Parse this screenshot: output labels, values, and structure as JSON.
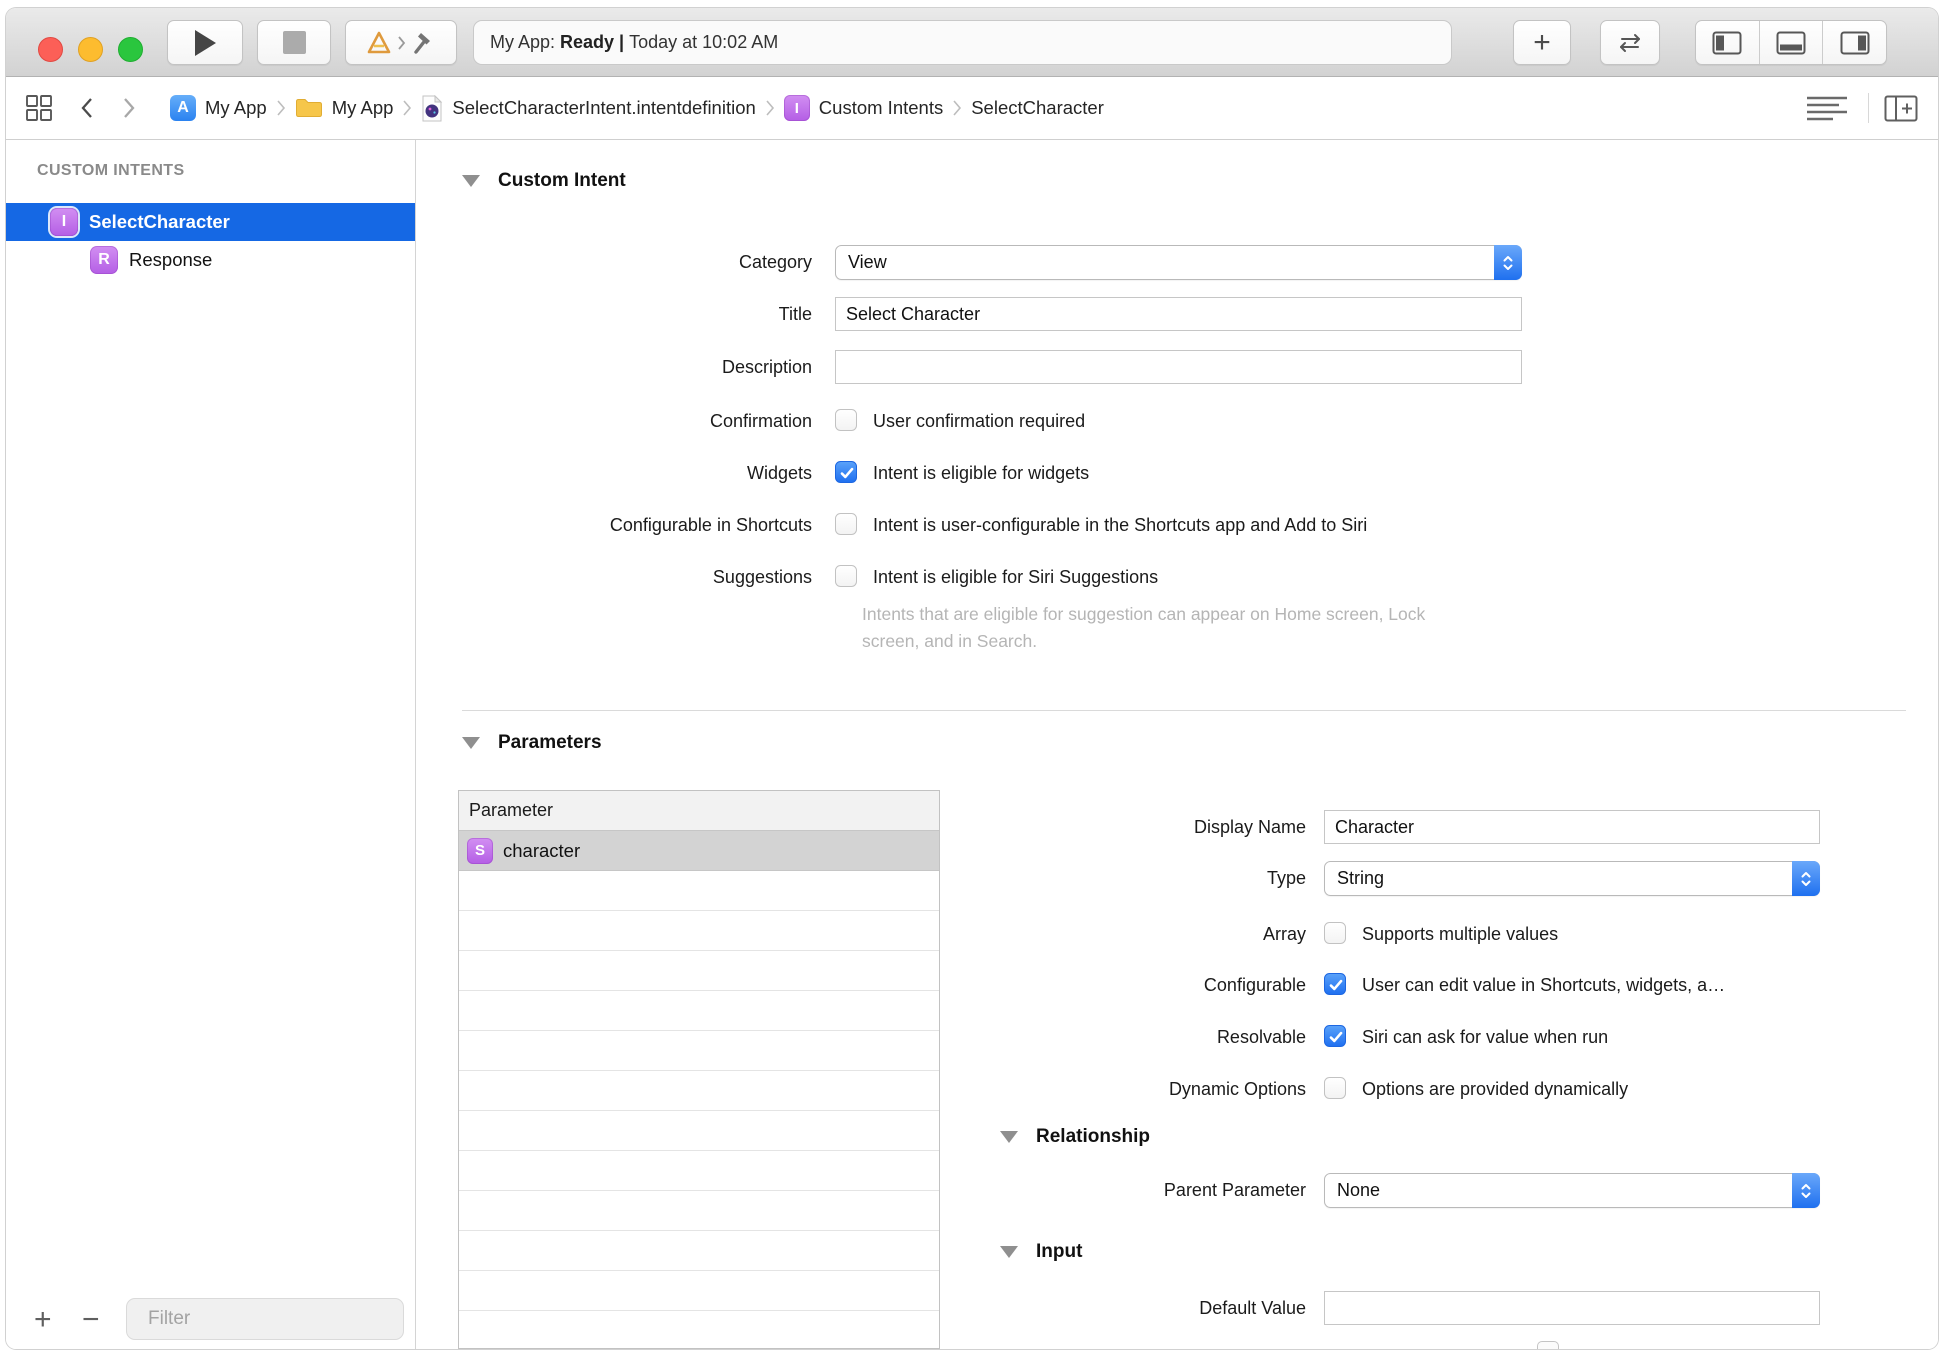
{
  "toolbar": {
    "status_project": "My App: ",
    "status_state": "Ready | ",
    "status_detail": "Today at 10:02 AM",
    "add_label": "+"
  },
  "jumpbar": {
    "crumbs": [
      {
        "label": "My App"
      },
      {
        "label": "My App"
      },
      {
        "label": "SelectCharacterIntent.intentdefinition"
      },
      {
        "label": "Custom Intents",
        "badge": "I"
      },
      {
        "label": "SelectCharacter"
      }
    ]
  },
  "sidebar": {
    "header": "CUSTOM INTENTS",
    "items": [
      {
        "badge": "I",
        "label": "SelectCharacter",
        "selected": true
      },
      {
        "badge": "R",
        "label": "Response",
        "selected": false
      }
    ],
    "add": "+",
    "remove": "−",
    "filter_placeholder": "Filter"
  },
  "editor": {
    "custom_intent": {
      "title": "Custom Intent",
      "category": {
        "label": "Category",
        "value": "View"
      },
      "title_field": {
        "label": "Title",
        "value": "Select Character"
      },
      "description": {
        "label": "Description",
        "value": ""
      },
      "confirmation": {
        "label": "Confirmation",
        "text": "User confirmation required",
        "checked": false
      },
      "widgets": {
        "label": "Widgets",
        "text": "Intent is eligible for widgets",
        "checked": true
      },
      "shortcuts": {
        "label": "Configurable in Shortcuts",
        "text": "Intent is user-configurable in the Shortcuts app and Add to Siri",
        "checked": false
      },
      "suggestions": {
        "label": "Suggestions",
        "text": "Intent is eligible for Siri Suggestions",
        "checked": false
      },
      "suggestions_help": "Intents that are eligible for suggestion can appear on Home screen, Lock screen, and in Search."
    },
    "parameters": {
      "title": "Parameters",
      "table": {
        "header": "Parameter",
        "rows": [
          {
            "badge": "S",
            "name": "character"
          }
        ]
      },
      "detail": {
        "display_name": {
          "label": "Display Name",
          "value": "Character"
        },
        "type": {
          "label": "Type",
          "value": "String"
        },
        "array": {
          "label": "Array",
          "text": "Supports multiple values",
          "checked": false
        },
        "configurable": {
          "label": "Configurable",
          "text": "User can edit value in Shortcuts, widgets, a…",
          "checked": true
        },
        "resolvable": {
          "label": "Resolvable",
          "text": "Siri can ask for value when run",
          "checked": true
        },
        "dynamic_options": {
          "label": "Dynamic Options",
          "text": "Options are provided dynamically",
          "checked": false
        }
      },
      "relationship": {
        "title": "Relationship",
        "parent": {
          "label": "Parent Parameter",
          "value": "None"
        }
      },
      "input": {
        "title": "Input",
        "default_value": {
          "label": "Default Value",
          "value": ""
        }
      }
    }
  },
  "colors": {
    "selection_blue": "#1568e4",
    "control_blue": "#2a7cf7",
    "intent_purple": "#bf6fe9",
    "traffic_red": "#fc5f57",
    "traffic_yellow": "#fdbc2f",
    "traffic_green": "#2ac63e"
  }
}
